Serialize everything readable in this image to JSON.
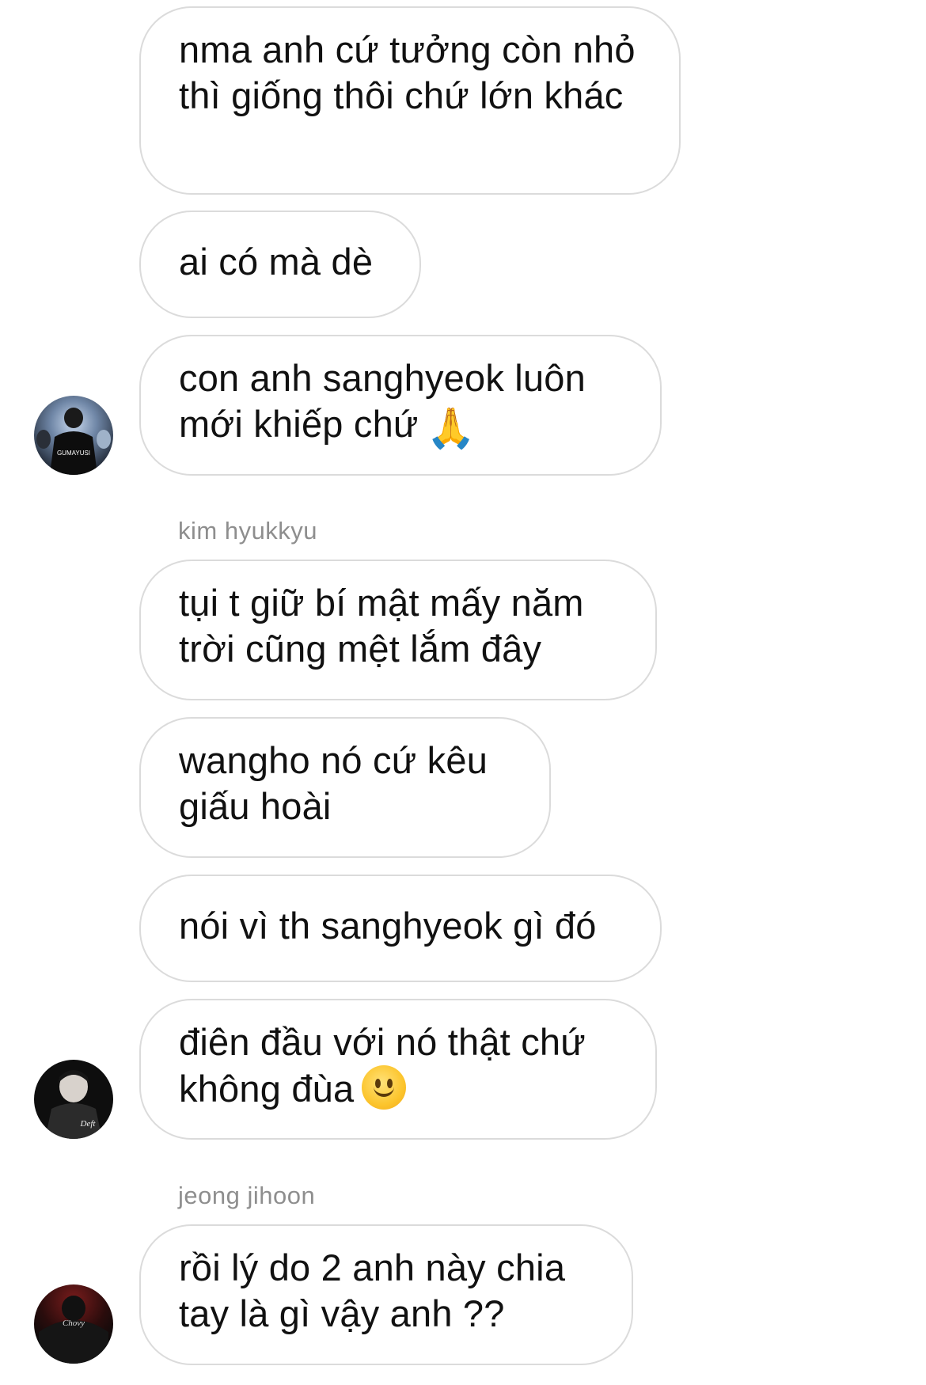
{
  "conversation": {
    "messages": [
      {
        "text": "nma anh cứ tưởng còn nhỏ thì giống thôi chứ lớn khác"
      },
      {
        "text": "ai có mà dè"
      },
      {
        "text": "con anh sanghyeok luôn mới khiếp chứ",
        "emoji": "🙏",
        "emoji_name": "folded-hands-emoji"
      },
      {
        "text": "tụi t giữ bí mật mấy năm trời cũng mệt lắm đây"
      },
      {
        "text": "wangho nó cứ kêu giấu hoài"
      },
      {
        "text": "nói vì th sanghyeok gì đó"
      },
      {
        "text": "điên đầu với nó thật chứ không đùa",
        "emoji_name": "slightly-smiling-face-emoji"
      },
      {
        "text": "rồi lý do 2 anh này chia tay là gì vậy anh ??"
      }
    ],
    "senders": [
      {
        "name": "kim hyukkyu",
        "avatar_caption": "Deft"
      },
      {
        "name": "jeong jihoon",
        "avatar_caption": "Chovy"
      }
    ],
    "first_avatar_caption": "GUMAYUSI"
  }
}
